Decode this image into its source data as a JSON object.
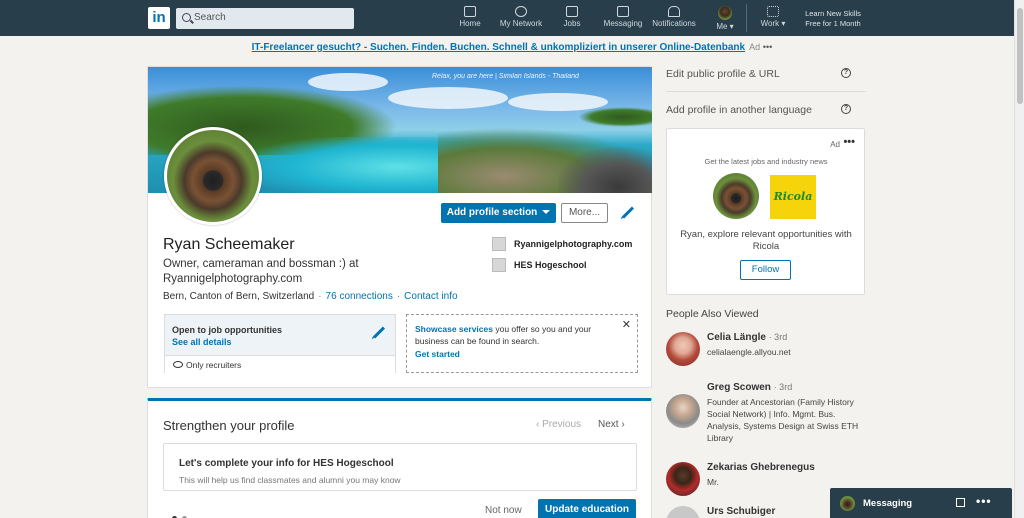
{
  "nav": {
    "logo": "in",
    "search_placeholder": "Search",
    "items": [
      {
        "label": "Home"
      },
      {
        "label": "My Network"
      },
      {
        "label": "Jobs"
      },
      {
        "label": "Messaging"
      },
      {
        "label": "Notifications"
      },
      {
        "label": "Me"
      },
      {
        "label": "Work"
      }
    ],
    "promo": "Learn New Skills Free for 1 Month"
  },
  "ad_banner": {
    "link": "IT-Freelancer gesucht? - Suchen. Finden. Buchen. Schnell & unkompliziert in unserer Online-Datenbank",
    "ad_label": "Ad",
    "more": "•••"
  },
  "profile": {
    "banner_text": "Relax, you are here | Similan Islands - Thailand",
    "add_section_label": "Add profile section",
    "more_label": "More...",
    "name": "Ryan Scheemaker",
    "headline": "Owner, cameraman and bossman :) at Ryannigelphotography.com",
    "location": "Bern, Canton of Bern, Switzerland",
    "connections": "76 connections",
    "contact": "Contact info",
    "website": "Ryannigelphotography.com",
    "school": "HES Hogeschool",
    "job_box": {
      "title": "Open to job opportunities",
      "link": "See all details",
      "visibility": "Only recruiters"
    },
    "showcase": {
      "bold": "Showcase services",
      "text": " you offer so you and your business can be found in search.",
      "link": "Get started",
      "close": "✕"
    }
  },
  "strengthen": {
    "title": "Strengthen your profile",
    "previous": "Previous",
    "next": "Next",
    "card_title": "Let's complete your info for HES Hogeschool",
    "card_sub": "This will help us find classmates and alumni you may know",
    "not_now": "Not now",
    "update": "Update education"
  },
  "right": {
    "edit_public": "Edit public profile & URL",
    "add_language": "Add profile in another language",
    "help": "?",
    "ad": {
      "label": "Ad",
      "more": "•••",
      "subtitle": "Get the latest jobs and industry news",
      "brand": "Ricola",
      "message": "Ryan, explore relevant opportunities with Ricola",
      "follow": "Follow"
    },
    "people_title": "People Also Viewed",
    "people": [
      {
        "name": "Celia Längle",
        "degree": "· 3rd",
        "desc": "celialaengle.allyou.net"
      },
      {
        "name": "Greg Scowen",
        "degree": "· 3rd",
        "desc": "Founder at Ancestorian (Family History Social Network) | Info. Mgmt. Bus. Analysis, Systems Design at Swiss ETH Library"
      },
      {
        "name": "Zekarias Ghebrenegus",
        "degree": "",
        "desc": "Mr."
      },
      {
        "name": "Urs Schubiger",
        "degree": "",
        "desc": ""
      }
    ]
  },
  "messaging": {
    "label": "Messaging",
    "more": "•••"
  },
  "colors": {
    "nav_bg": "#283e4a",
    "accent": "#0073b1",
    "page_bg": "#f3f2ef"
  }
}
